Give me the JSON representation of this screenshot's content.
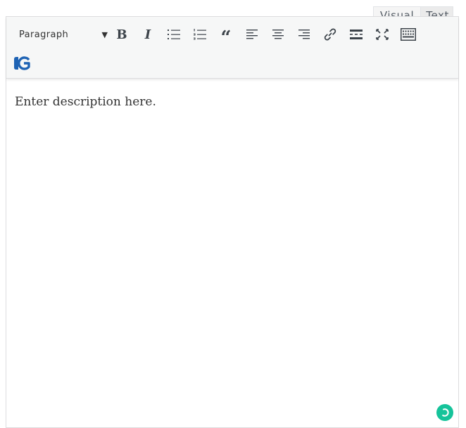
{
  "tabs": {
    "visual_label": "Visual",
    "text_label": "Text"
  },
  "toolbar": {
    "format_select": {
      "selected": "Paragraph",
      "arrow": "▼"
    },
    "bold_label": "B",
    "italic_label": "I",
    "blockquote_label": "“",
    "icons": [
      "bold-icon",
      "italic-icon",
      "bulleted-list-icon",
      "numbered-list-icon",
      "blockquote-icon",
      "align-left-icon",
      "align-center-icon",
      "align-right-icon",
      "link-icon",
      "read-more-icon",
      "fullscreen-icon",
      "keyboard-icon",
      "grammarly-g-icon"
    ]
  },
  "editor": {
    "content_text": "Enter description here."
  },
  "colors": {
    "toolbar_bg": "#f6f7f7",
    "icon": "#3c434a",
    "grammarly": "#15c39a",
    "g_logo": "#1e63b4"
  }
}
